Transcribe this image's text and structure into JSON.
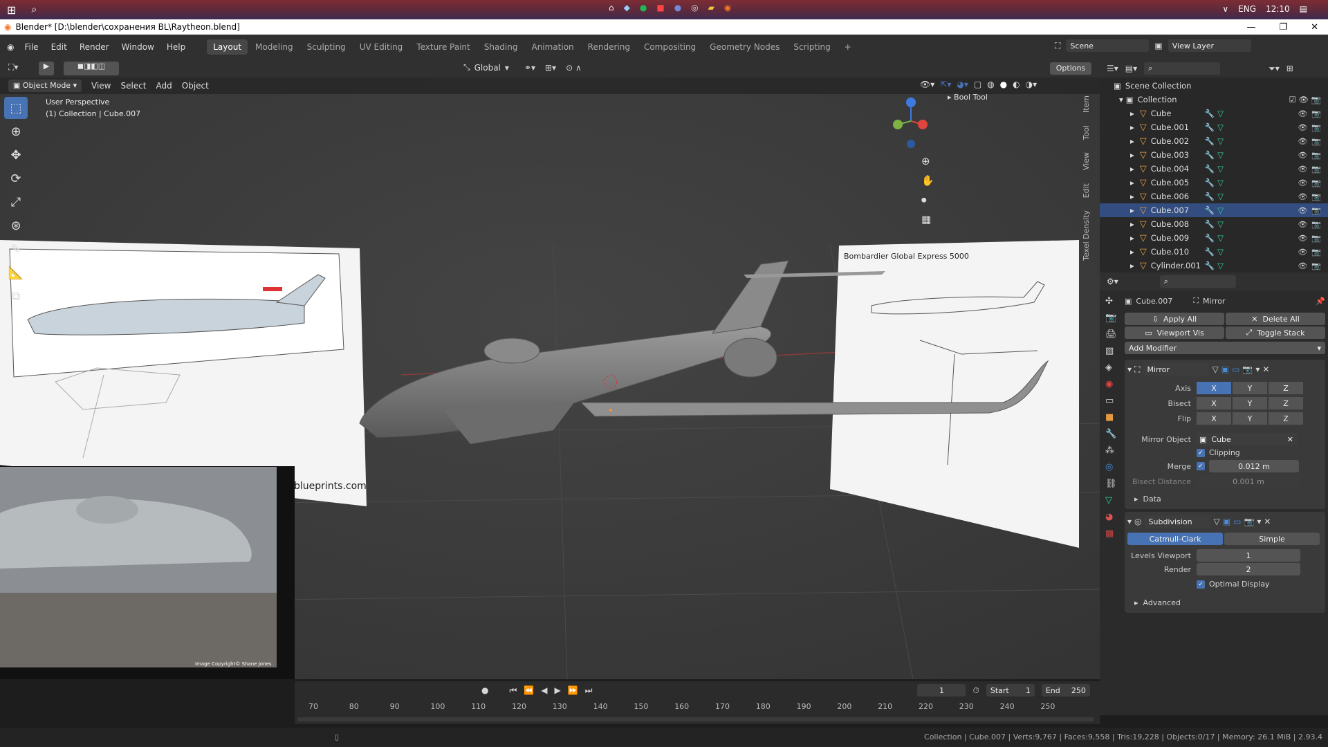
{
  "taskbar": {
    "lang": "ENG",
    "time": "12:10"
  },
  "window": {
    "title": "Blender* [D:\\blender\\сохранения BL\\Raytheon.blend]"
  },
  "menu": {
    "file": "File",
    "edit": "Edit",
    "render": "Render",
    "window": "Window",
    "help": "Help"
  },
  "workspaces": [
    "Layout",
    "Modeling",
    "Sculpting",
    "UV Editing",
    "Texture Paint",
    "Shading",
    "Animation",
    "Rendering",
    "Compositing",
    "Geometry Nodes",
    "Scripting"
  ],
  "scene": {
    "name": "Scene",
    "view_layer": "View Layer"
  },
  "viewport_header": {
    "orientation": "Global",
    "options": "Options",
    "mode": "Object Mode",
    "view": "View",
    "select": "Select",
    "add": "Add",
    "object": "Object"
  },
  "viewport": {
    "perspective": "User Perspective",
    "collection_info": "(1) Collection | Cube.007",
    "bool_tool": "Bool Tool",
    "blueprint_title": "Bombardier Global Express 5000",
    "blueprint_site": "blueprints.com",
    "photo_credit": "Image Copyright© Shane Jones"
  },
  "side_tabs": [
    "Item",
    "Tool",
    "View",
    "Edit",
    "Texel Density"
  ],
  "outliner": {
    "scene_collection": "Scene Collection",
    "collection": "Collection",
    "items": [
      "Cube",
      "Cube.001",
      "Cube.002",
      "Cube.003",
      "Cube.004",
      "Cube.005",
      "Cube.006",
      "Cube.007",
      "Cube.008",
      "Cube.009",
      "Cube.010",
      "Cylinder.001"
    ]
  },
  "properties": {
    "object_name": "Cube.007",
    "modifier_name": "Mirror",
    "apply_all": "Apply All",
    "delete_all": "Delete All",
    "viewport_vis": "Viewport Vis",
    "toggle_stack": "Toggle Stack",
    "add_modifier": "Add Modifier",
    "mirror": {
      "name": "Mirror",
      "axis_label": "Axis",
      "bisect_label": "Bisect",
      "flip_label": "Flip",
      "x": "X",
      "y": "Y",
      "z": "Z",
      "mirror_object_label": "Mirror Object",
      "mirror_object": "Cube",
      "clipping": "Clipping",
      "merge_label": "Merge",
      "merge_value": "0.012 m",
      "bisect_distance_label": "Bisect Distance",
      "bisect_distance": "0.001 m",
      "data": "Data"
    },
    "subdivision": {
      "name": "Subdivision",
      "catmull": "Catmull-Clark",
      "simple": "Simple",
      "levels_label": "Levels Viewport",
      "levels": "1",
      "render_label": "Render",
      "render": "2",
      "optimal": "Optimal Display",
      "advanced": "Advanced"
    }
  },
  "timeline": {
    "frame": "1",
    "start_label": "Start",
    "start": "1",
    "end_label": "End",
    "end": "250",
    "ticks": [
      "70",
      "80",
      "90",
      "100",
      "110",
      "120",
      "130",
      "140",
      "150",
      "160",
      "170",
      "180",
      "190",
      "200",
      "210",
      "220",
      "230",
      "240",
      "250"
    ]
  },
  "status": {
    "text": "Collection | Cube.007 | Verts:9,767 | Faces:9,558 | Tris:19,228 | Objects:0/17 | Memory: 26.1 MiB | 2.93.4"
  },
  "colors": {
    "accent": "#4772b3",
    "object_orange": "#e69b40",
    "x_axis": "#e0443e",
    "y_axis": "#7cb342",
    "z_axis": "#3e7be0"
  }
}
